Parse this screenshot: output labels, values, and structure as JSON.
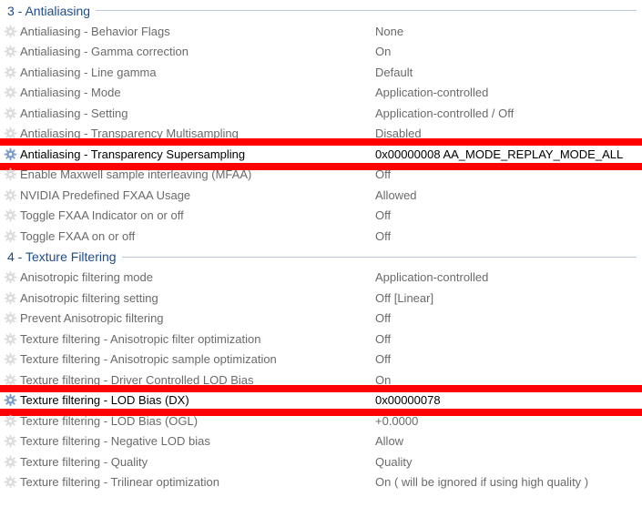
{
  "sections": [
    {
      "title": "3 - Antialiasing",
      "rows": [
        {
          "name": "Antialiasing - Behavior Flags",
          "value": "None"
        },
        {
          "name": "Antialiasing - Gamma correction",
          "value": "On"
        },
        {
          "name": "Antialiasing - Line gamma",
          "value": "Default"
        },
        {
          "name": "Antialiasing - Mode",
          "value": "Application-controlled"
        },
        {
          "name": "Antialiasing - Setting",
          "value": "Application-controlled / Off"
        },
        {
          "name": "Antialiasing - Transparency Multisampling",
          "value": "Disabled"
        },
        {
          "name": "Antialiasing - Transparency Supersampling",
          "value": "0x00000008 AA_MODE_REPLAY_MODE_ALL",
          "highlighted": true
        },
        {
          "name": "Enable Maxwell sample interleaving (MFAA)",
          "value": "Off"
        },
        {
          "name": "NVIDIA Predefined FXAA Usage",
          "value": "Allowed"
        },
        {
          "name": "Toggle FXAA Indicator on or off",
          "value": "Off"
        },
        {
          "name": "Toggle FXAA on or off",
          "value": "Off"
        }
      ]
    },
    {
      "title": "4 - Texture Filtering",
      "rows": [
        {
          "name": "Anisotropic filtering mode",
          "value": "Application-controlled"
        },
        {
          "name": "Anisotropic filtering setting",
          "value": "Off [Linear]"
        },
        {
          "name": "Prevent Anisotropic filtering",
          "value": "Off"
        },
        {
          "name": "Texture filtering - Anisotropic filter optimization",
          "value": "Off"
        },
        {
          "name": "Texture filtering - Anisotropic sample optimization",
          "value": "Off"
        },
        {
          "name": "Texture filtering - Driver Controlled LOD Bias",
          "value": "On"
        },
        {
          "name": "Texture filtering - LOD Bias (DX)",
          "value": "0x00000078",
          "highlighted": true
        },
        {
          "name": "Texture filtering - LOD Bias (OGL)",
          "value": "+0.0000"
        },
        {
          "name": "Texture filtering - Negative LOD bias",
          "value": "Allow"
        },
        {
          "name": "Texture filtering - Quality",
          "value": "Quality"
        },
        {
          "name": "Texture filtering - Trilinear optimization",
          "value": "On ( will be ignored if using high quality )"
        }
      ]
    }
  ],
  "colors": {
    "section_title": "#1e4b8c",
    "highlight_bar": "#ff0000",
    "row_text": "#6a6a6a",
    "highlight_text": "#000000"
  },
  "icons": {
    "row_icon": "gear-icon"
  }
}
